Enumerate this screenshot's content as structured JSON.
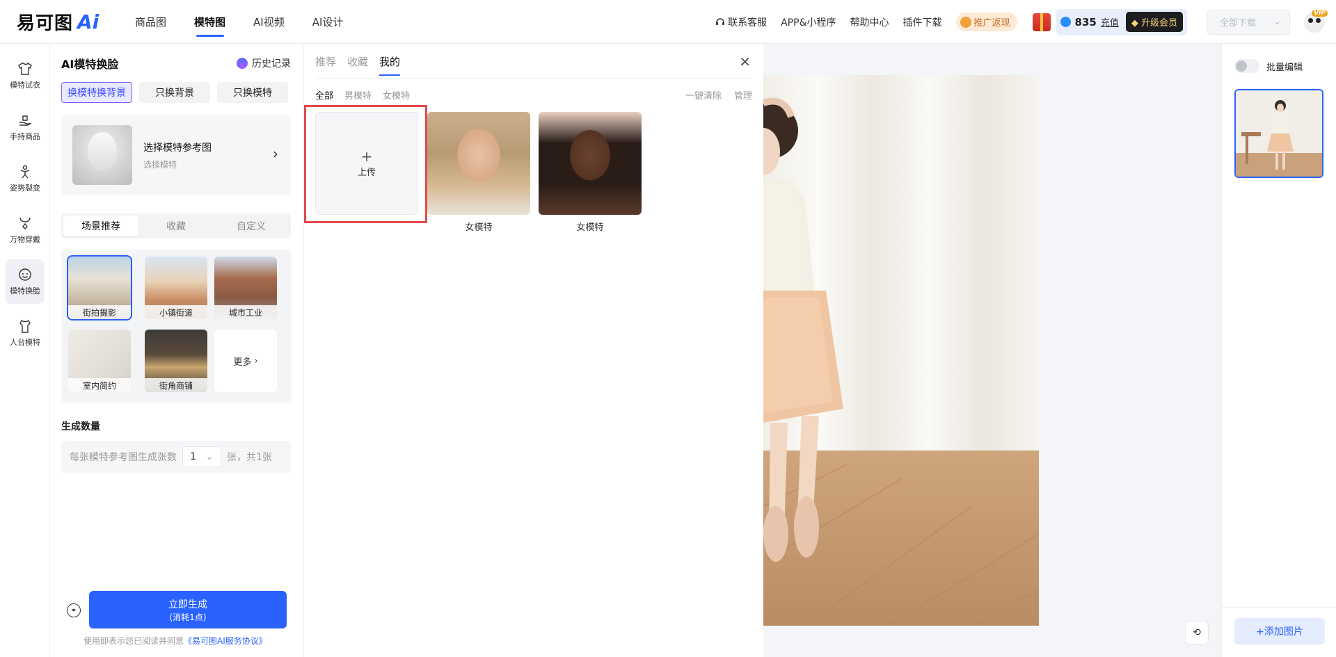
{
  "header": {
    "logo_text": "易可图",
    "logo_ai": "Ai",
    "nav": [
      "商品图",
      "模特图",
      "AI视频",
      "AI设计"
    ],
    "nav_active": 1,
    "links": [
      "联系客服",
      "APP&小程序",
      "帮助中心",
      "插件下载"
    ],
    "promo": "推广返现",
    "credits": "835",
    "recharge": "充值",
    "upgrade": "升级会员",
    "download": "全部下载",
    "vip_badge": "VIP"
  },
  "sidebar": {
    "items": [
      "模特试衣",
      "手持商品",
      "姿势裂变",
      "万物穿戴",
      "模特换脸",
      "人台模特"
    ],
    "active": 4
  },
  "panel": {
    "title": "AI模特换脸",
    "history": "历史记录",
    "modes": [
      "换模特换背景",
      "只换背景",
      "只换模特"
    ],
    "ref_title": "选择模特参考图",
    "ref_sub": "选择模特",
    "scene_tabs": [
      "场景推荐",
      "收藏",
      "自定义"
    ],
    "scenes": [
      "街拍摄影",
      "小镇街道",
      "城市工业",
      "室内简约",
      "街角商铺"
    ],
    "more": "更多",
    "gen_title": "生成数量",
    "gen_desc": "每张模特参考图生成张数",
    "gen_value": "1",
    "gen_suffix": "张，共1张",
    "gen_button": "立即生成",
    "gen_cost": "(消耗1点)",
    "agree_prefix": "使用即表示您已阅读并同意",
    "agree_link": "《易可图AI服务协议》"
  },
  "picker": {
    "tabs": [
      "推荐",
      "收藏",
      "我的"
    ],
    "active_tab": 2,
    "filters": [
      "全部",
      "男模特",
      "女模特"
    ],
    "active_filter": 0,
    "actions": [
      "一键清除",
      "管理"
    ],
    "upload_label": "上传",
    "models": [
      "女模特",
      "女模特"
    ]
  },
  "canvas": {
    "rotate_icon": "rotate-icon"
  },
  "rpanel": {
    "batch_label": "批量编辑",
    "add_button": "+添加图片"
  }
}
